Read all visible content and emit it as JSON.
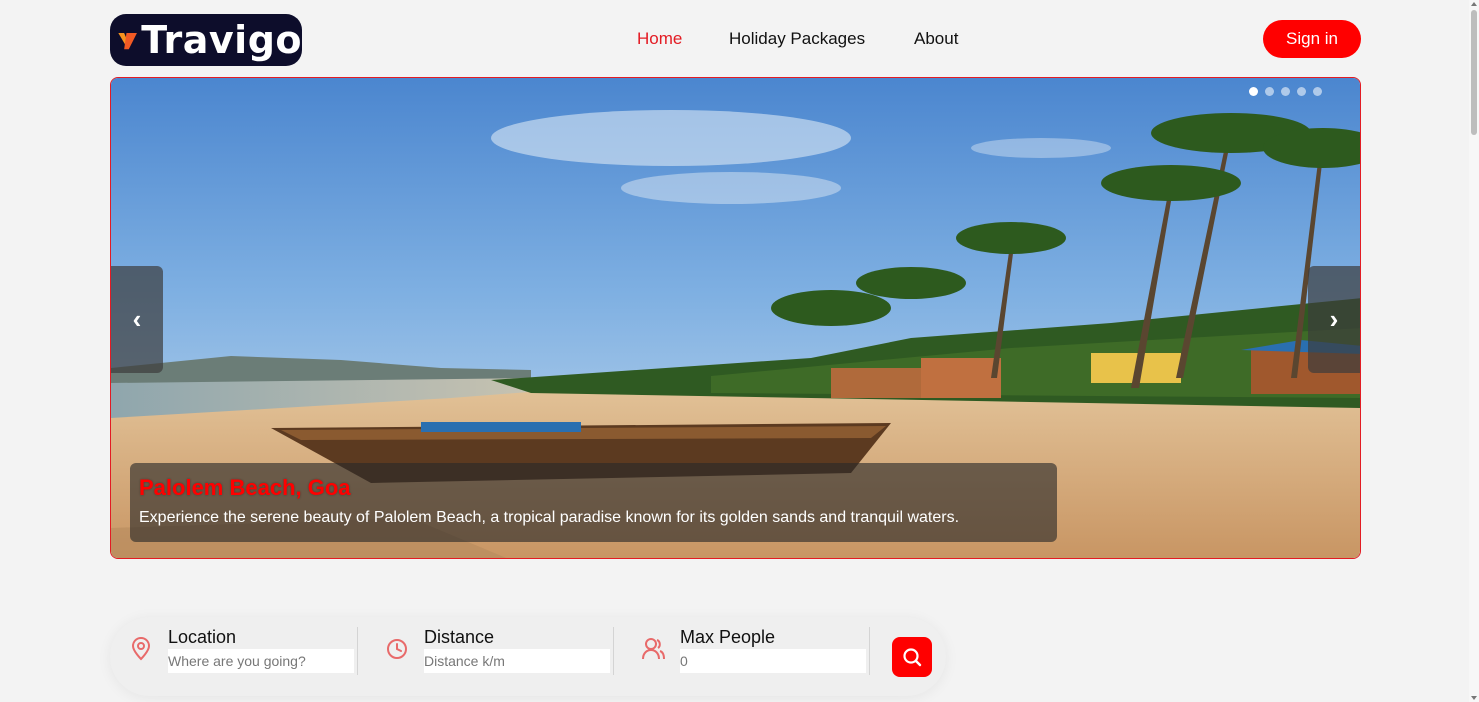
{
  "brand": {
    "name": "Travigo"
  },
  "nav": {
    "items": [
      {
        "label": "Home",
        "active": true
      },
      {
        "label": "Holiday Packages",
        "active": false
      },
      {
        "label": "About",
        "active": false
      }
    ],
    "signin_label": "Sign in"
  },
  "hero": {
    "slide_count": 5,
    "active_slide": 0,
    "prev_icon": "‹",
    "next_icon": "›",
    "caption": {
      "title": "Palolem Beach, Goa",
      "description": "Experience the serene beauty of Palolem Beach, a tropical paradise known for its golden sands and tranquil waters."
    }
  },
  "search": {
    "location": {
      "label": "Location",
      "placeholder": "Where are you going?",
      "icon": "location-pin-icon"
    },
    "distance": {
      "label": "Distance",
      "placeholder": "Distance k/m",
      "icon": "clock-icon"
    },
    "people": {
      "label": "Max People",
      "placeholder": "0",
      "icon": "users-icon"
    },
    "button_icon": "search-icon"
  },
  "colors": {
    "accent": "#ff0000",
    "nav_active": "#e31b23",
    "logo_bg": "#0d0d2b",
    "logo_mark": "#f7931e",
    "icon_tint": "#e86a6a"
  }
}
